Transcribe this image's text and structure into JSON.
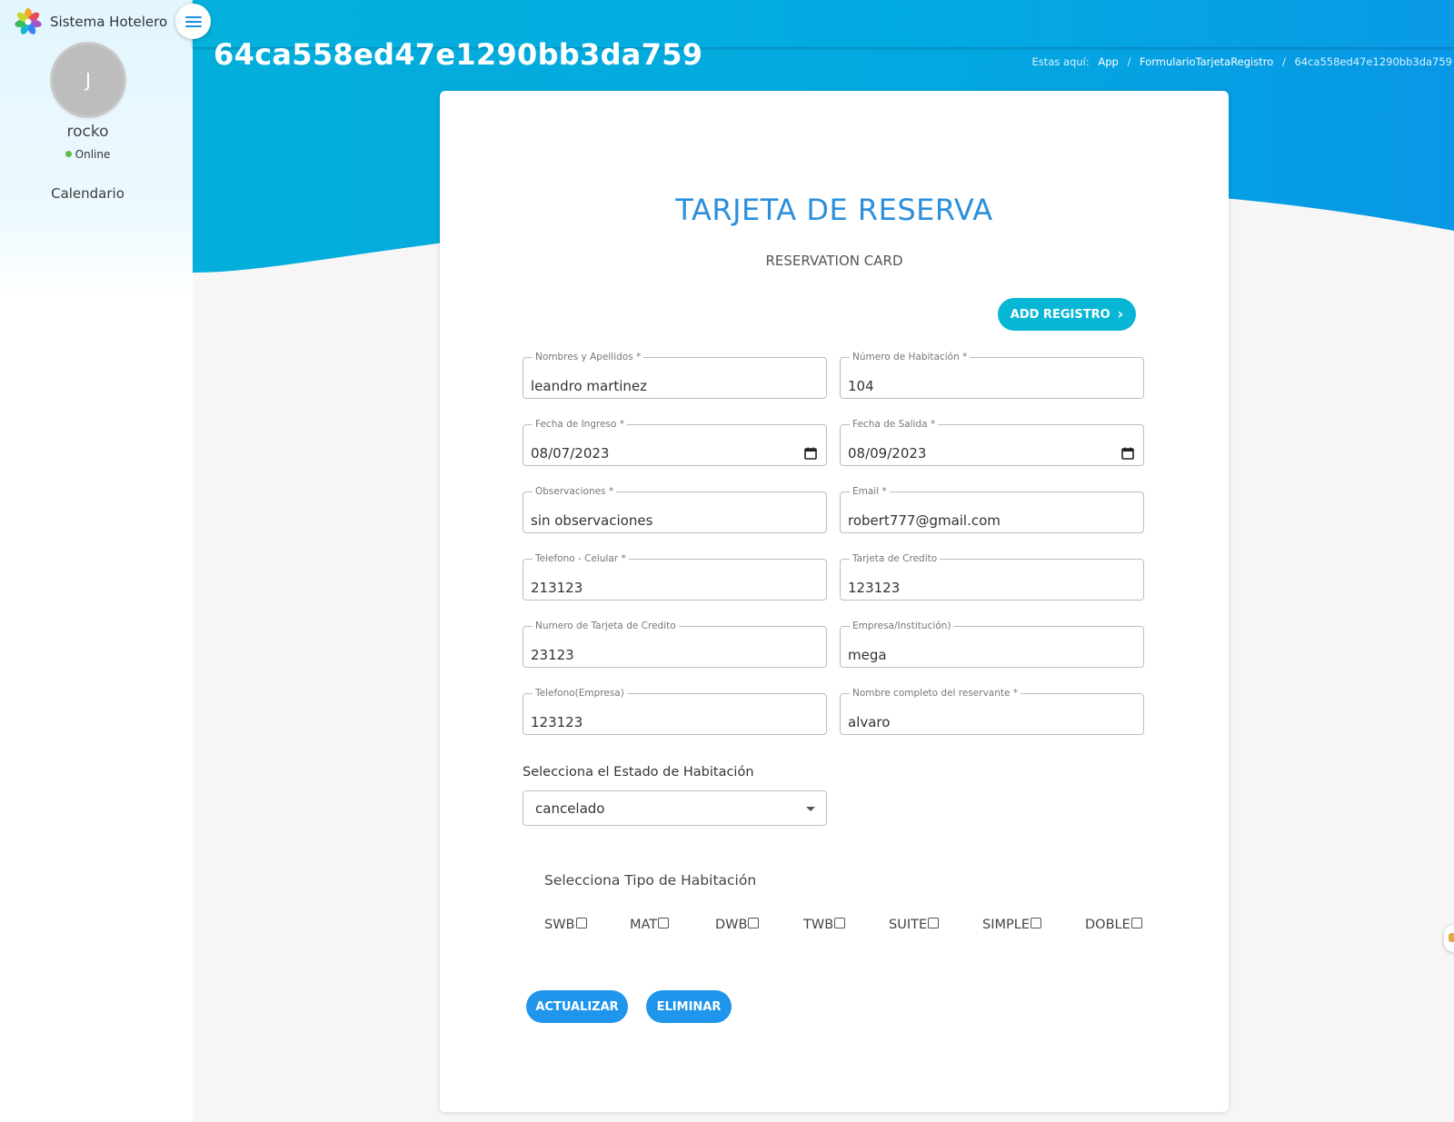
{
  "brand": {
    "title": "Sistema Hotelero"
  },
  "user": {
    "initial": "J",
    "name": "rocko",
    "status": "Online"
  },
  "nav": {
    "items": [
      {
        "label": "Calendario"
      }
    ]
  },
  "page": {
    "title": "64ca558ed47e1290bb3da759"
  },
  "breadcrumb": {
    "prefix": "Estas aquí:",
    "items": [
      "App",
      "FormularioTarjetaRegistro",
      "64ca558ed47e1290bb3da759"
    ]
  },
  "card": {
    "title": "TARJETA DE RESERVA",
    "subtitle": "RESERVATION CARD",
    "add_button": "ADD REGISTRO",
    "fields": {
      "nombres": {
        "label": "Nombres y Apellidos *",
        "value": "leandro martinez"
      },
      "habitacion": {
        "label": "Número de Habitación *",
        "value": "104"
      },
      "ingreso": {
        "label": "Fecha de Ingreso *",
        "value": "08/07/2023"
      },
      "salida": {
        "label": "Fecha de Salida *",
        "value": "08/09/2023"
      },
      "observaciones": {
        "label": "Observaciones *",
        "value": "sin observaciones"
      },
      "email": {
        "label": "Email *",
        "value": "robert777@gmail.com"
      },
      "telefono": {
        "label": "Telefono - Celular *",
        "value": "213123"
      },
      "tarjeta": {
        "label": "Tarjeta de Credito",
        "value": "123123"
      },
      "num_tarjeta": {
        "label": "Numero de Tarjeta de Credito",
        "value": "23123"
      },
      "empresa": {
        "label": "Empresa/Institución)",
        "value": "mega"
      },
      "tel_empresa": {
        "label": "Telefono(Empresa)",
        "value": "123123"
      },
      "reservante": {
        "label": "Nombre completo del reservante *",
        "value": "alvaro"
      }
    },
    "estado": {
      "label": "Selecciona el Estado de Habitación",
      "value": "cancelado"
    },
    "tipo": {
      "label": "Selecciona Tipo de Habitación",
      "options": [
        {
          "label": "SWB",
          "checked": false
        },
        {
          "label": "MAT",
          "checked": false
        },
        {
          "label": "DWB",
          "checked": false
        },
        {
          "label": "TWB",
          "checked": false
        },
        {
          "label": "SUITE",
          "checked": false
        },
        {
          "label": "SIMPLE",
          "checked": false
        },
        {
          "label": "DOBLE",
          "checked": false
        }
      ]
    },
    "actions": {
      "update": "ACTUALIZAR",
      "delete": "ELIMINAR"
    }
  },
  "colors": {
    "header": "#04b1dc",
    "accent": "#1f95ec",
    "add_button": "#06b6d4",
    "title": "#2b8fdb",
    "online": "#5dbb46"
  }
}
